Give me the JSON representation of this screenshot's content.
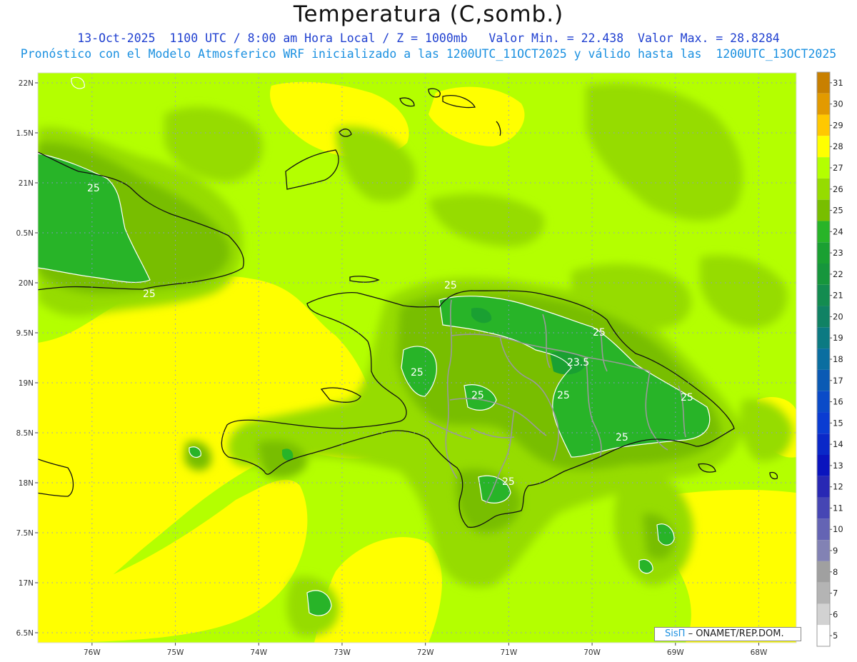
{
  "header": {
    "title": "Temperatura (C,somb.)",
    "line1": "13-Oct-2025  1100 UTC / 8:00 am Hora Local / Z = 1000mb   Valor Min. = 22.438  Valor Max. = 28.8284",
    "line2": "Pronóstico con el Modelo Atmosferico WRF inicializado a las 1200UTC_11OCT2025 y válido hasta las  1200UTC_13OCT2025"
  },
  "axes": {
    "lon_labels": [
      "76W",
      "75W",
      "74W",
      "73W",
      "72W",
      "71W",
      "70W",
      "69W",
      "68W"
    ],
    "lon_values": [
      -76,
      -75,
      -74,
      -73,
      -72,
      -71,
      -70,
      -69,
      -68
    ],
    "lat_labels": [
      "22N",
      "1.5N",
      "21N",
      "0.5N",
      "20N",
      "9.5N",
      "19N",
      "8.5N",
      "18N",
      "7.5N",
      "17N",
      "6.5N"
    ],
    "lat_values": [
      22,
      21.5,
      21,
      20.5,
      20,
      19.5,
      19,
      18.5,
      18,
      17.5,
      17,
      16.5
    ],
    "lon_range": [
      -76.65,
      -67.55
    ],
    "lat_range": [
      16.4,
      22.1
    ]
  },
  "colorbar": {
    "labels": [
      "31",
      "30",
      "29",
      "28",
      "27",
      "26",
      "25",
      "24",
      "23",
      "22",
      "21",
      "20",
      "19",
      "18",
      "17",
      "16",
      "15",
      "14",
      "13",
      "12",
      "11",
      "10",
      "9",
      "8",
      "7",
      "6",
      "5"
    ],
    "colors": [
      "#c88000",
      "#e29a00",
      "#ffc800",
      "#ffff00",
      "#b4ff00",
      "#96dc00",
      "#78be00",
      "#28b428",
      "#1aa032",
      "#16963c",
      "#138c50",
      "#108264",
      "#0c7a82",
      "#0a6ea0",
      "#0a5ab4",
      "#0a4bc8",
      "#0a3cd2",
      "#0a28c8",
      "#0a14be",
      "#2828b4",
      "#4646b4",
      "#6464b4",
      "#8282b4",
      "#a0a0a0",
      "#b4b4b4",
      "#d2d2d2",
      "#ffffff"
    ]
  },
  "contour_labels": [
    "25",
    "25",
    "25",
    "25",
    "25",
    "25",
    "23.5",
    "25",
    "25",
    "25",
    "25"
  ],
  "credit": {
    "brand": "SisΠ",
    "org": "– ONAMET/REP.DOM."
  }
}
